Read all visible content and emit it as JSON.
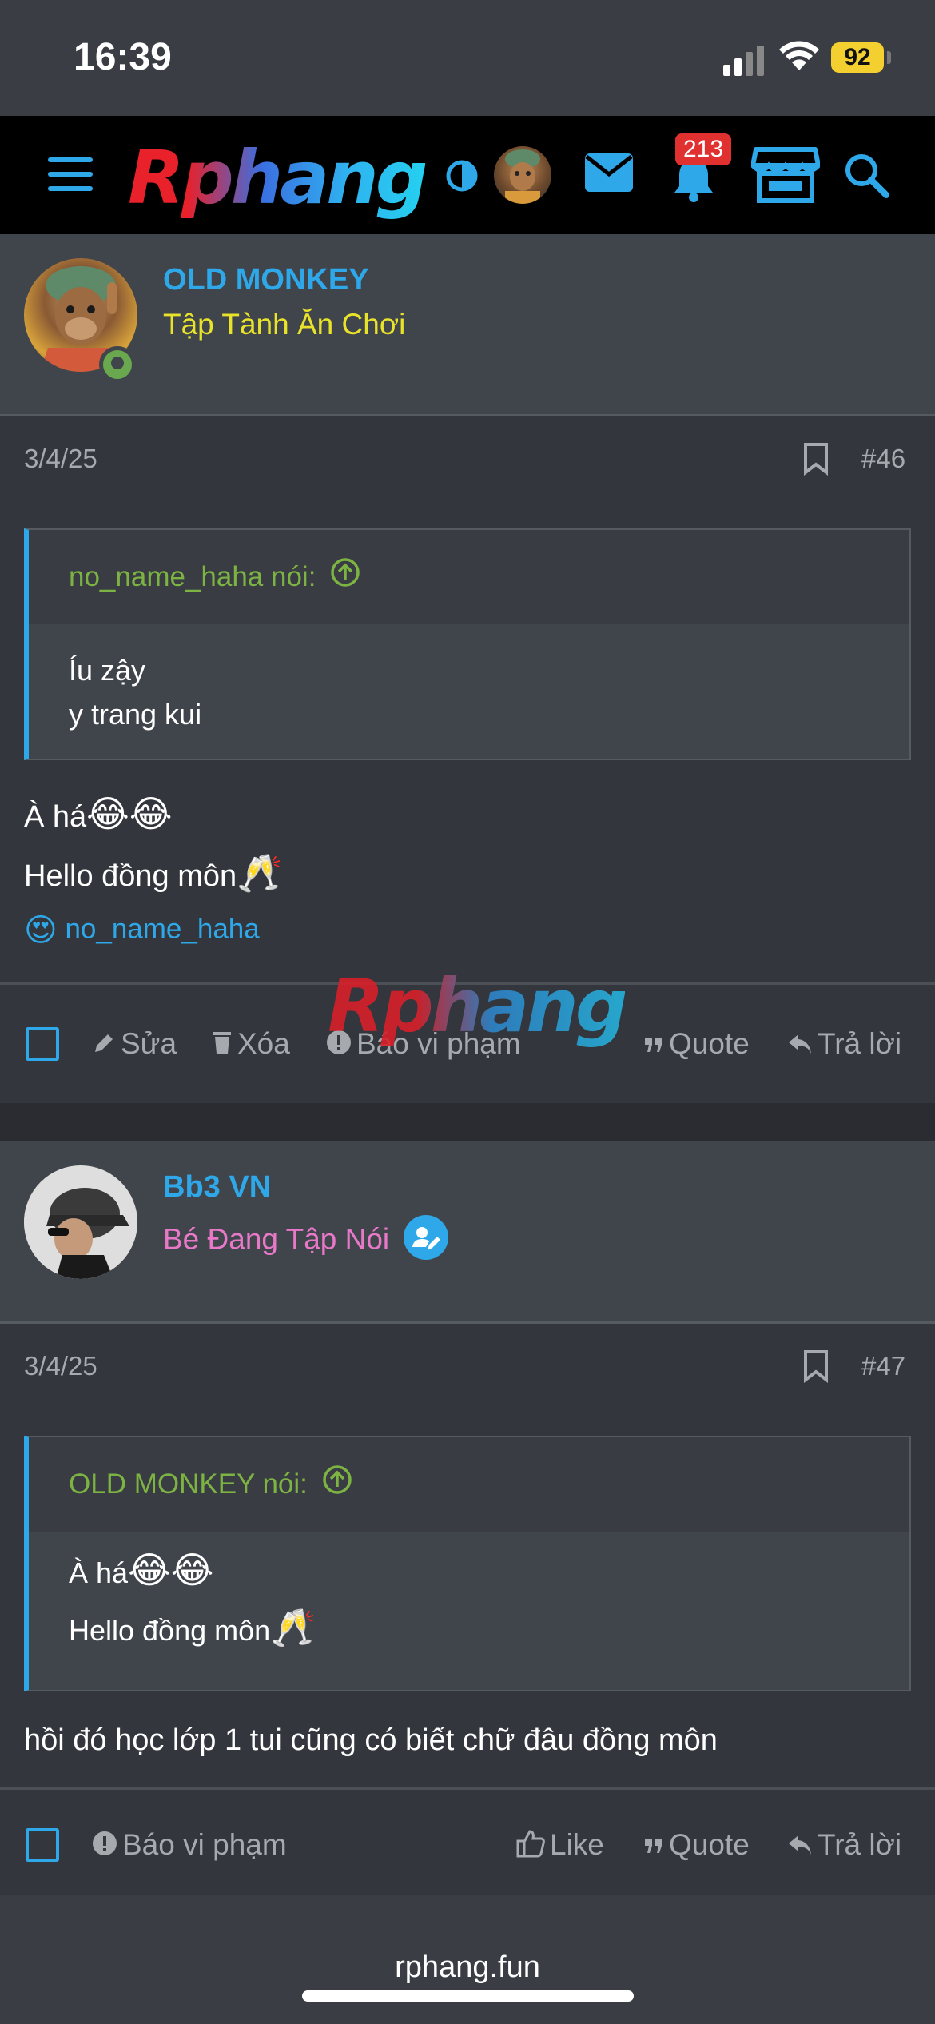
{
  "status_bar": {
    "time": "16:39",
    "battery": "92"
  },
  "navbar": {
    "logo": "Rphang",
    "notification_count": "213",
    "accent_color": "#2ea8e8"
  },
  "watermark": "Rphang",
  "posts": [
    {
      "username": "OLD MONKEY",
      "user_title": "Tập Tành Ăn Chơi",
      "user_title_color": "#e8e32a",
      "date": "3/4/25",
      "number": "#46",
      "quote": {
        "author": "no_name_haha nói:",
        "lines": [
          "Íu zậy",
          "y trang kui"
        ]
      },
      "lines": [
        "À há",
        "Hello đồng môn"
      ],
      "emojis": [
        "😂😂",
        "🥂"
      ],
      "reaction": {
        "emoji": "😍",
        "user": "no_name_haha"
      },
      "actions": [
        "Sửa",
        "Xóa",
        "Báo vi phạm",
        "Quote",
        "Trả lời"
      ]
    },
    {
      "username": "Bb3 VN",
      "user_title": "Bé Đang Tập Nói",
      "user_title_color": "#e879c9",
      "date": "3/4/25",
      "number": "#47",
      "quote": {
        "author": "OLD MONKEY nói:",
        "lines": [
          "À há",
          "Hello đồng môn"
        ]
      },
      "text": "hồi đó học lớp 1 tui cũng có biết chữ đâu đồng môn",
      "actions": [
        "Báo vi phạm",
        "Like",
        "Quote",
        "Trả lời"
      ]
    }
  ],
  "browser": {
    "url": "rphang.fun"
  }
}
